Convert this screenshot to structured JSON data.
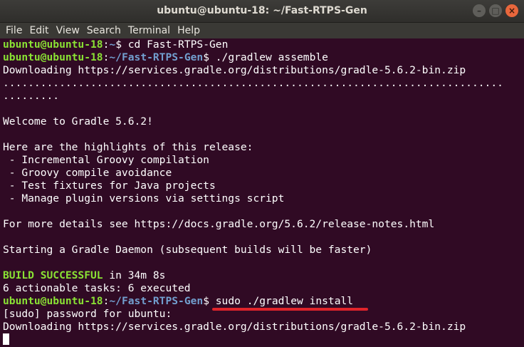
{
  "window": {
    "title": "ubuntu@ubuntu-18: ~/Fast-RTPS-Gen",
    "controls": [
      "–",
      "□",
      "×"
    ]
  },
  "menu": [
    "File",
    "Edit",
    "View",
    "Search",
    "Terminal",
    "Help"
  ],
  "terminal": {
    "lines": [
      {
        "type": "prompt",
        "user": "ubuntu@ubuntu-18",
        "path": "~",
        "cmd": " cd Fast-RTPS-Gen"
      },
      {
        "type": "prompt",
        "user": "ubuntu@ubuntu-18",
        "path": "~/Fast-RTPS-Gen",
        "cmd": " ./gradlew assemble"
      },
      {
        "type": "text",
        "text": "Downloading https://services.gradle.org/distributions/gradle-5.6.2-bin.zip"
      },
      {
        "type": "text",
        "text": "................................................................................"
      },
      {
        "type": "text",
        "text": "........."
      },
      {
        "type": "text",
        "text": ""
      },
      {
        "type": "text",
        "text": "Welcome to Gradle 5.6.2!"
      },
      {
        "type": "text",
        "text": ""
      },
      {
        "type": "text",
        "text": "Here are the highlights of this release:"
      },
      {
        "type": "text",
        "text": " - Incremental Groovy compilation"
      },
      {
        "type": "text",
        "text": " - Groovy compile avoidance"
      },
      {
        "type": "text",
        "text": " - Test fixtures for Java projects"
      },
      {
        "type": "text",
        "text": " - Manage plugin versions via settings script"
      },
      {
        "type": "text",
        "text": ""
      },
      {
        "type": "text",
        "text": "For more details see https://docs.gradle.org/5.6.2/release-notes.html"
      },
      {
        "type": "text",
        "text": ""
      },
      {
        "type": "text",
        "text": "Starting a Gradle Daemon (subsequent builds will be faster)"
      },
      {
        "type": "text",
        "text": ""
      },
      {
        "type": "build",
        "status": "BUILD SUCCESSFUL",
        "rest": " in 34m 8s"
      },
      {
        "type": "text",
        "text": "6 actionable tasks: 6 executed"
      },
      {
        "type": "prompt",
        "user": "ubuntu@ubuntu-18",
        "path": "~/Fast-RTPS-Gen",
        "cmd": " sudo ./gradlew install"
      },
      {
        "type": "text",
        "text": "[sudo] password for ubuntu:"
      },
      {
        "type": "text",
        "text": "Downloading https://services.gradle.org/distributions/gradle-5.6.2-bin.zip"
      },
      {
        "type": "cursor"
      }
    ]
  },
  "colors": {
    "background": "#300a24",
    "prompt_user": "#8ae234",
    "prompt_path": "#729fcf",
    "annotation_underline": "#e0242b"
  }
}
